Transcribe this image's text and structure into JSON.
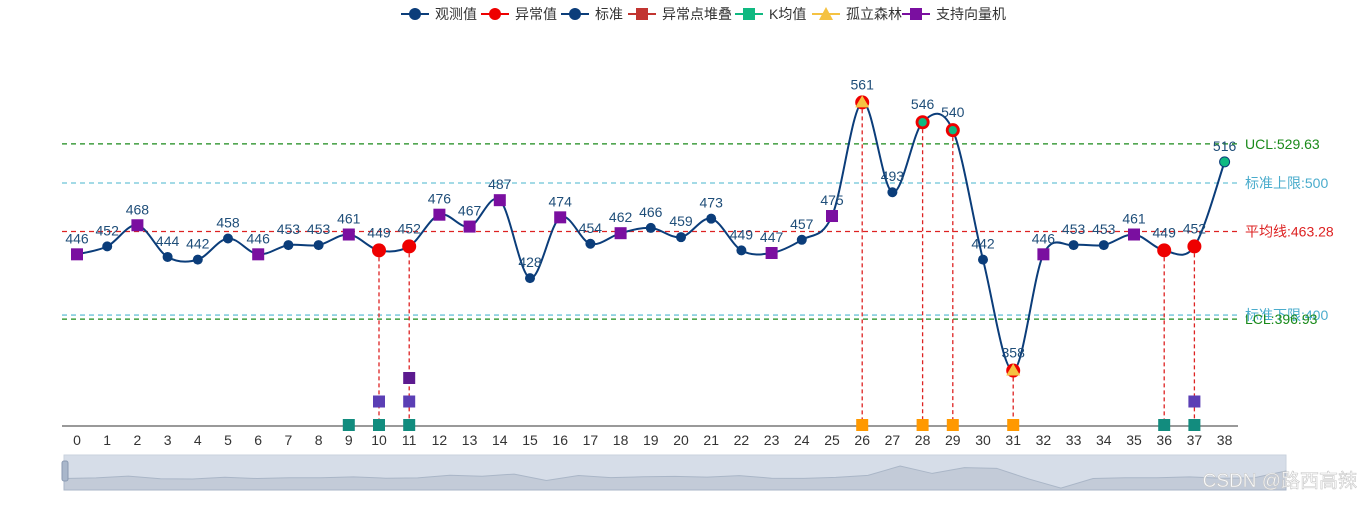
{
  "legend": [
    {
      "label": "观测值",
      "color": "#0b3d7a",
      "marker": "circle-line"
    },
    {
      "label": "异常值",
      "color": "#ee0000",
      "marker": "circle-line"
    },
    {
      "label": "标准",
      "color": "#0b3d7a",
      "marker": "circle-line"
    },
    {
      "label": "异常点堆叠",
      "color": "#c23531",
      "marker": "square-line"
    },
    {
      "label": "K均值",
      "color": "#10b981",
      "marker": "square-line"
    },
    {
      "label": "孤立森林",
      "color": "#f5c242",
      "marker": "triangle-line"
    },
    {
      "label": "支持向量机",
      "color": "#7a0fa0",
      "marker": "square-line"
    }
  ],
  "watermark": "CSDN @路西高辣",
  "chart_data": {
    "type": "line",
    "x": [
      0,
      1,
      2,
      3,
      4,
      5,
      6,
      7,
      8,
      9,
      10,
      11,
      12,
      13,
      14,
      15,
      16,
      17,
      18,
      19,
      20,
      21,
      22,
      23,
      24,
      25,
      26,
      27,
      28,
      29,
      30,
      31,
      32,
      33,
      34,
      35,
      36,
      37,
      38
    ],
    "series": [
      {
        "name": "观测值",
        "values": [
          446,
          452,
          468,
          444,
          442,
          458,
          446,
          453,
          453,
          461,
          449,
          452,
          476,
          467,
          487,
          428,
          474,
          454,
          462,
          466,
          459,
          473,
          449,
          447,
          457,
          475,
          561,
          493,
          546,
          540,
          442,
          358,
          446,
          453,
          453,
          461,
          449,
          452,
          516
        ]
      }
    ],
    "value_labels": [
      "446",
      "452",
      "468",
      "444",
      "442",
      "458",
      "446",
      "453",
      "453",
      "461",
      "449",
      "452",
      "476",
      "467",
      "487",
      "428",
      "474",
      "454",
      "462",
      "466",
      "459",
      "473",
      "449",
      "447",
      "457",
      "475",
      "561",
      "493",
      "546",
      "540",
      "442",
      "358",
      "446",
      "453",
      "453",
      "461",
      "449",
      "452",
      "516"
    ],
    "svm_points": [
      0,
      2,
      6,
      9,
      12,
      13,
      14,
      16,
      18,
      23,
      25,
      32,
      35
    ],
    "anomalies": [
      10,
      11,
      26,
      28,
      29,
      31,
      36,
      37
    ],
    "kmeans_highlight": [
      28,
      29,
      38
    ],
    "iforest_highlight": [
      26,
      31
    ],
    "bottom_markers": [
      {
        "x": 9,
        "stack": [
          {
            "level": 0,
            "method": "K均值",
            "color": "#128c7e"
          }
        ]
      },
      {
        "x": 10,
        "stack": [
          {
            "level": 0,
            "method": "K均值",
            "color": "#128c7e"
          },
          {
            "level": 1,
            "method": "支持向量机",
            "color": "#5b3fb5"
          }
        ]
      },
      {
        "x": 11,
        "stack": [
          {
            "level": 0,
            "method": "K均值",
            "color": "#128c7e"
          },
          {
            "level": 1,
            "method": "支持向量机",
            "color": "#5b3fb5"
          },
          {
            "level": 2,
            "method": "支持向量机",
            "color": "#5c1a8f"
          }
        ]
      },
      {
        "x": 26,
        "stack": [
          {
            "level": 0,
            "method": "孤立森林",
            "color": "#ff9900"
          }
        ]
      },
      {
        "x": 28,
        "stack": [
          {
            "level": 0,
            "method": "孤立森林",
            "color": "#ff9900"
          }
        ]
      },
      {
        "x": 29,
        "stack": [
          {
            "level": 0,
            "method": "孤立森林",
            "color": "#ff9900"
          }
        ]
      },
      {
        "x": 31,
        "stack": [
          {
            "level": 0,
            "method": "孤立森林",
            "color": "#ff9900"
          }
        ]
      },
      {
        "x": 36,
        "stack": [
          {
            "level": 0,
            "method": "K均值",
            "color": "#128c7e"
          }
        ]
      },
      {
        "x": 37,
        "stack": [
          {
            "level": 0,
            "method": "K均值",
            "color": "#128c7e"
          },
          {
            "level": 1,
            "method": "支持向量机",
            "color": "#5b3fb5"
          }
        ]
      }
    ],
    "reference_lines": [
      {
        "name": "UCL",
        "label": "UCL:529.63",
        "value": 529.63,
        "color": "#1a8a1a",
        "text_color": "#1a8a1a"
      },
      {
        "name": "upper_limit",
        "label": "标准上限:500",
        "value": 500,
        "color": "#6cc3d8",
        "text_color": "#4aaccc"
      },
      {
        "name": "mean",
        "label": "平均线:463.28",
        "value": 463.28,
        "color": "#dd2222",
        "text_color": "#dd2222"
      },
      {
        "name": "lower_limit",
        "label": "标准下限:400",
        "value": 400,
        "color": "#6cc3d8",
        "text_color": "#4aaccc"
      },
      {
        "name": "LCL",
        "label": "LCL:396.93",
        "value": 396.93,
        "color": "#1a8a1a",
        "text_color": "#1a8a1a"
      }
    ],
    "y_axis_visible": false,
    "grid": false,
    "colors": {
      "line": "#0b3d7a",
      "anomaly": "#ee0000",
      "svm": "#7a0fa0",
      "kmeans": "#10b981",
      "iforest": "#f5c242",
      "dropline": "#dd2222",
      "label": "#1f4e79"
    },
    "legend_position": "top-center",
    "data_zoom_slider": true
  }
}
